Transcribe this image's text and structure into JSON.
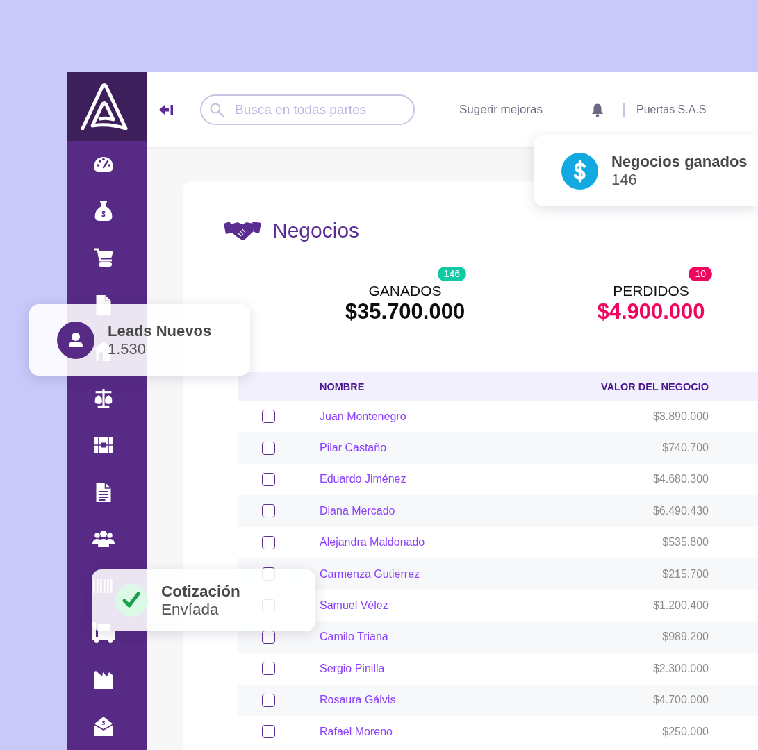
{
  "header": {
    "search": {
      "placeholder": "Busca en todas partes"
    },
    "suggest_link": "Sugerir mejoras",
    "company": "Puertas S.A.S"
  },
  "floating_cards": [
    {
      "kind": "deals",
      "title": "Negocios ganados",
      "value": "146"
    },
    {
      "kind": "leads",
      "title": "Leads Nuevos",
      "value": "1.530"
    },
    {
      "kind": "quote",
      "title": "Cotización",
      "value": "Envíada"
    }
  ],
  "page": {
    "title": "Negocios",
    "stats": [
      {
        "kind": "won",
        "badge": "146",
        "label": "GANADOS",
        "value": "$35.700.000"
      },
      {
        "kind": "lost",
        "badge": "10",
        "label": "PERDIDOS",
        "value": "$4.900.000"
      }
    ]
  },
  "table": {
    "columns": [
      "NOMBRE",
      "VALOR DEL NEGOCIO"
    ],
    "rows": [
      {
        "checked": false,
        "name": "Juan Montenegro",
        "value": "$3.890.000"
      },
      {
        "checked": false,
        "name": "Pilar Castaño",
        "value": "$740.700"
      },
      {
        "checked": false,
        "name": "Eduardo Jiménez",
        "value": "$4.680.300"
      },
      {
        "checked": false,
        "name": "Diana Mercado",
        "value": "$6.490.430"
      },
      {
        "checked": false,
        "name": "Alejandra Maldonado",
        "value": "$535.800"
      },
      {
        "checked": false,
        "name": "Carmenza Gutierrez",
        "value": "$215.700"
      },
      {
        "checked": false,
        "name": "Samuel Vélez",
        "value": "$1.200.400"
      },
      {
        "checked": false,
        "name": "Camilo Triana",
        "value": "$989.200"
      },
      {
        "checked": false,
        "name": "Sergio Pinilla",
        "value": "$2.300.000"
      },
      {
        "checked": false,
        "name": "Rosaura Gálvis",
        "value": "$4.700.000"
      },
      {
        "checked": false,
        "name": "Rafael Moreno",
        "value": "$250.000"
      }
    ]
  }
}
